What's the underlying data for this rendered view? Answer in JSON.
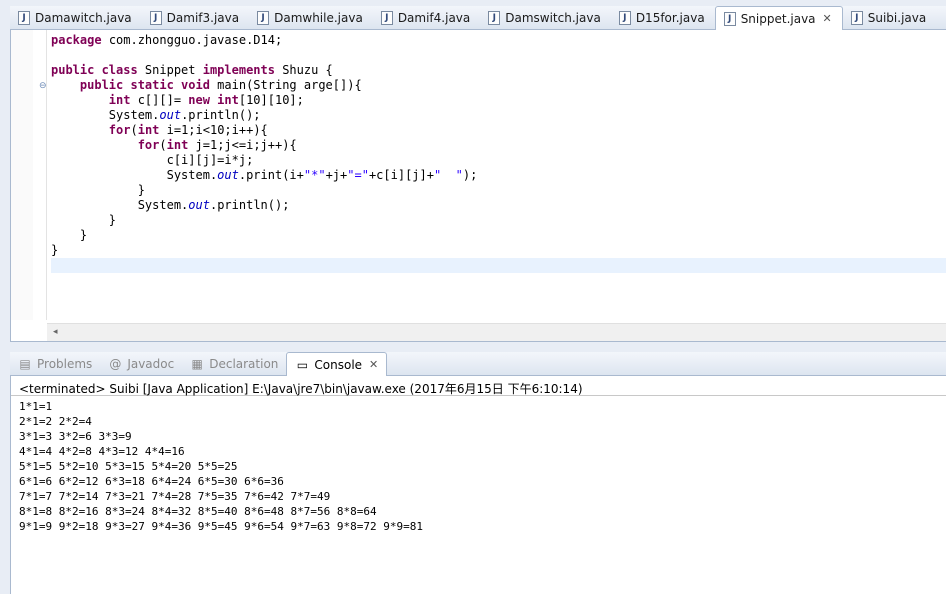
{
  "editor_tabs": [
    {
      "label": "Damawitch.java",
      "icon": "java-file-icon",
      "active": false
    },
    {
      "label": "Damif3.java",
      "icon": "java-file-icon",
      "active": false
    },
    {
      "label": "Damwhile.java",
      "icon": "java-file-icon",
      "active": false
    },
    {
      "label": "Damif4.java",
      "icon": "java-file-icon",
      "active": false
    },
    {
      "label": "Damswitch.java",
      "icon": "java-file-icon",
      "active": false
    },
    {
      "label": "D15for.java",
      "icon": "java-file-icon",
      "active": false
    },
    {
      "label": "Snippet.java",
      "icon": "java-file-icon",
      "active": true
    },
    {
      "label": "Suibi.java",
      "icon": "java-file-icon",
      "active": false
    }
  ],
  "code_lines": [
    "package com.zhongguo.javase.D14;",
    "",
    "public class Snippet implements Shuzu {",
    "    public static void main(String arge[]){",
    "        int c[][]= new int[10][10];",
    "        System.out.println();",
    "        for(int i=1;i<10;i++){",
    "            for(int j=1;j<=i;j++){",
    "                c[i][j]=i*j;",
    "                System.out.print(i+\"*\"+j+\"=\"+c[i][j]+\"  \");",
    "            }",
    "            System.out.println();",
    "        }",
    "    }",
    "}",
    ""
  ],
  "view_tabs": [
    {
      "label": "Problems",
      "icon": "problems-icon",
      "active": false
    },
    {
      "label": "Javadoc",
      "icon": "at-icon",
      "active": false
    },
    {
      "label": "Declaration",
      "icon": "declaration-icon",
      "active": false
    },
    {
      "label": "Console",
      "icon": "console-icon",
      "active": true
    }
  ],
  "console": {
    "status": "<terminated> Suibi [Java Application] E:\\Java\\jre7\\bin\\javaw.exe (2017年6月15日 下午6:10:14)",
    "output": [
      "1*1=1",
      "2*1=2 2*2=4",
      "3*1=3 3*2=6 3*3=9",
      "4*1=4 4*2=8 4*3=12 4*4=16",
      "5*1=5 5*2=10 5*3=15 5*4=20 5*5=25",
      "6*1=6 6*2=12 6*3=18 6*4=24 6*5=30 6*6=36",
      "7*1=7 7*2=14 7*3=21 7*4=28 7*5=35 7*6=42 7*7=49",
      "8*1=8 8*2=16 8*3=24 8*4=32 8*5=40 8*6=48 8*7=56 8*8=64",
      "9*1=9 9*2=18 9*3=27 9*4=36 9*5=45 9*6=54 9*7=63 9*8=72 9*9=81"
    ]
  },
  "colors": {
    "keyword": "#7f0055",
    "string": "#2a00ff",
    "field": "#0000c0",
    "current_line": "#e8f2fe"
  }
}
